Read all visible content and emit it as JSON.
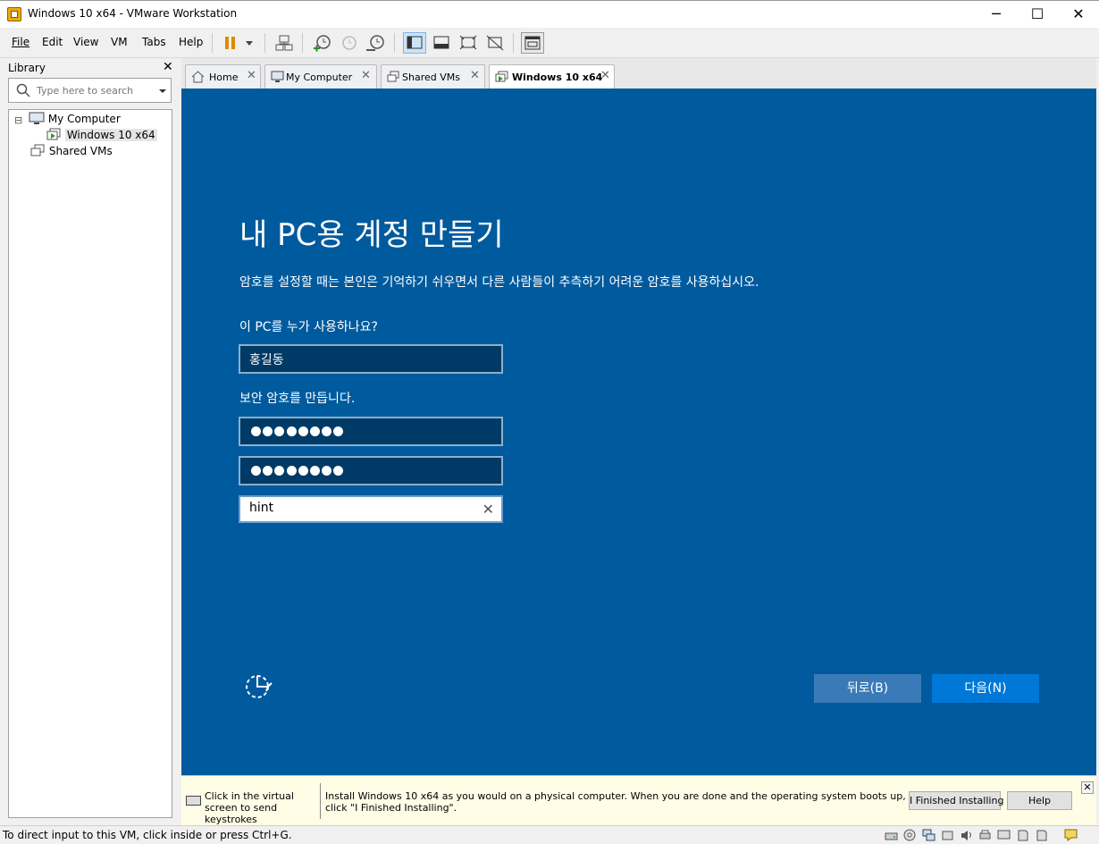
{
  "window": {
    "title": "Windows 10 x64 - VMware Workstation",
    "minimize_glyph": "─",
    "maximize_glyph": "☐",
    "close_glyph": "✕"
  },
  "menu": [
    "File",
    "Edit",
    "View",
    "VM",
    "Tabs",
    "Help"
  ],
  "library": {
    "title": "Library",
    "close_glyph": "✕",
    "search_placeholder": "Type here to search",
    "tree": {
      "expander": "⊟",
      "my_computer": "My Computer",
      "vm": "Windows 10 x64",
      "shared": "Shared VMs"
    }
  },
  "tabs": [
    {
      "label": "Home",
      "close": "✕"
    },
    {
      "label": "My Computer",
      "close": "✕"
    },
    {
      "label": "Shared VMs",
      "close": "✕"
    },
    {
      "label": "Windows 10 x64",
      "close": "✕"
    }
  ],
  "oobe": {
    "title": "내 PC용 계정 만들기",
    "description": "암호를 설정할 때는 본인은 기억하기 쉬우면서 다른 사람들이 추측하기 어려운 암호를 사용하십시오.",
    "who_label": "이 PC를 누가 사용하나요?",
    "username": "홍길동",
    "password_label": "보안 암호를 만듭니다.",
    "password_length": 8,
    "confirm_length": 8,
    "hint_value": "hint",
    "hint_clear": "✕",
    "back_button": "뒤로(B)",
    "next_button": "다음(N)"
  },
  "hintbar": {
    "click_text": "Click in the virtual screen to send keystrokes",
    "message": "Install Windows 10 x64 as you would on a physical computer. When you are done and the operating system boots up, click \"I Finished Installing\".",
    "finished_button": "I Finished Installing",
    "help_button": "Help",
    "close_glyph": "✕"
  },
  "status": {
    "text": "To direct input to this VM, click inside or press Ctrl+G."
  },
  "colors": {
    "oobe_background": "#005a9e",
    "next_button": "#0078d7",
    "back_button": "#3b7ab8",
    "field_background": "#003a66",
    "hintbar_background": "#fffde6"
  }
}
